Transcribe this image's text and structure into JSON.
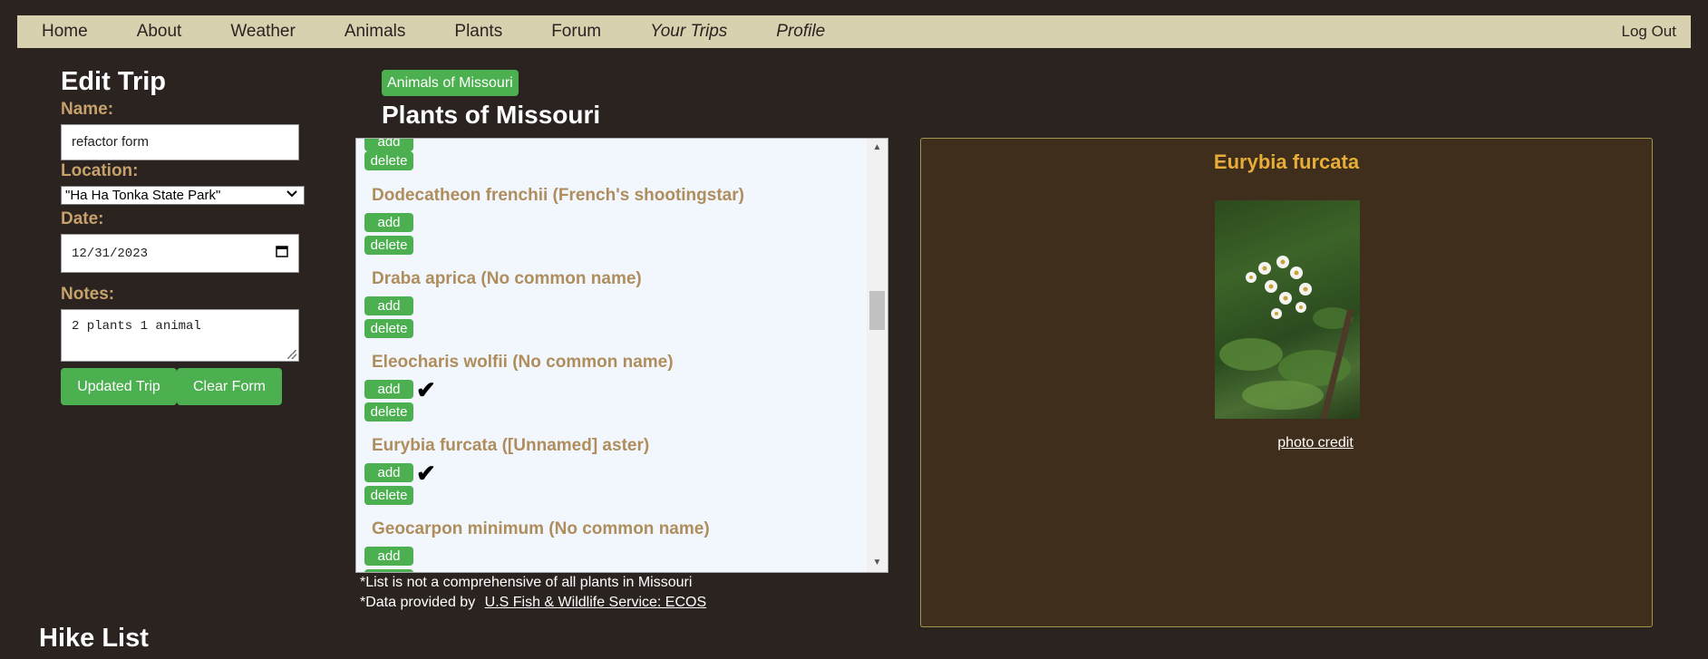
{
  "nav": {
    "items": [
      "Home",
      "About",
      "Weather",
      "Animals",
      "Plants",
      "Forum",
      "Your Trips",
      "Profile"
    ],
    "logout": "Log Out"
  },
  "edit_trip": {
    "title": "Edit Trip",
    "name_label": "Name:",
    "name_value": "refactor form",
    "location_label": "Location:",
    "location_value": "\"Ha Ha Tonka State Park\"",
    "date_label": "Date:",
    "date_value": "12/31/2023",
    "notes_label": "Notes:",
    "notes_value": "2 plants 1 animal",
    "update_button": "Updated Trip",
    "clear_button": "Clear Form"
  },
  "plants_section": {
    "animals_link": "Animals of Missouri",
    "title": "Plants of Missouri",
    "partial_top": {
      "delete_label": "delete"
    },
    "items": [
      {
        "name": "Dodecatheon frenchii (French's shootingstar)",
        "add": "add",
        "delete": "delete",
        "checked": false
      },
      {
        "name": "Draba aprica (No common name)",
        "add": "add",
        "delete": "delete",
        "checked": false
      },
      {
        "name": "Eleocharis wolfii (No common name)",
        "add": "add",
        "delete": "delete",
        "checked": true
      },
      {
        "name": "Eurybia furcata ([Unnamed] aster)",
        "add": "add",
        "delete": "delete",
        "checked": true
      },
      {
        "name": "Geocarpon minimum (No common name)",
        "add": "add",
        "delete": "delete",
        "checked": false
      }
    ],
    "footnote_1": "*List is not a comprehensive of all plants in Missouri",
    "footnote_2_prefix": "*Data provided by",
    "footnote_2_link": "U.S Fish & Wildlife Service: ECOS"
  },
  "detail": {
    "title": "Eurybia furcata",
    "photo_credit": "photo credit"
  },
  "hike_list": {
    "title": "Hike List"
  },
  "icons": {
    "check": "checkmark-icon",
    "select": "chevron-down-icon",
    "calendar": "calendar-icon"
  }
}
